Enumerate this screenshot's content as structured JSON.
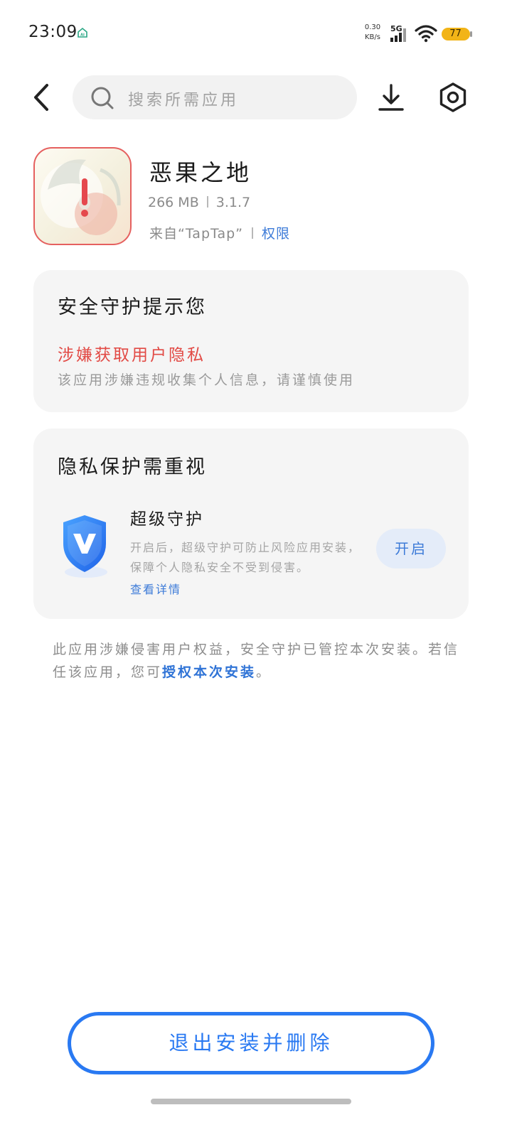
{
  "status_bar": {
    "time": "23:09",
    "net_speed_value": "0.30",
    "net_speed_unit": "KB/s",
    "network_type": "5G",
    "battery_level": "77",
    "battery_color": "#f2b417"
  },
  "toolbar": {
    "search_placeholder": "搜索所需应用",
    "back_icon": "chevron-left-icon",
    "download_icon": "download-icon",
    "settings_icon": "settings-hexagon-icon"
  },
  "app": {
    "name": "恶果之地",
    "size": "266 MB",
    "version": "3.1.7",
    "source": "来自“TapTap”",
    "permissions_label": "权限"
  },
  "security_card": {
    "title": "安全守护提示您",
    "risk_title": "涉嫌获取用户隐私",
    "risk_desc": "该应用涉嫌违规收集个人信息，请谨慎使用"
  },
  "privacy_card": {
    "title": "隐私保护需重视",
    "guard_title": "超级守护",
    "guard_desc": "开启后，超级守护可防止风险应用安装，保障个人隐私安全不受到侵害。",
    "guard_link": "查看详情",
    "enable_label": "开启"
  },
  "notice": {
    "text_before": "此应用涉嫌侵害用户权益，安全守护已管控本次安装。若信任该应用，您可",
    "link_label": "授权本次安装",
    "text_after": "。"
  },
  "bottom": {
    "exit_label": "退出安装并删除"
  },
  "colors": {
    "accent_blue": "#2979f2",
    "link_blue": "#3d7bd8",
    "danger_red": "#e24a45",
    "card_bg": "#f5f5f5"
  }
}
